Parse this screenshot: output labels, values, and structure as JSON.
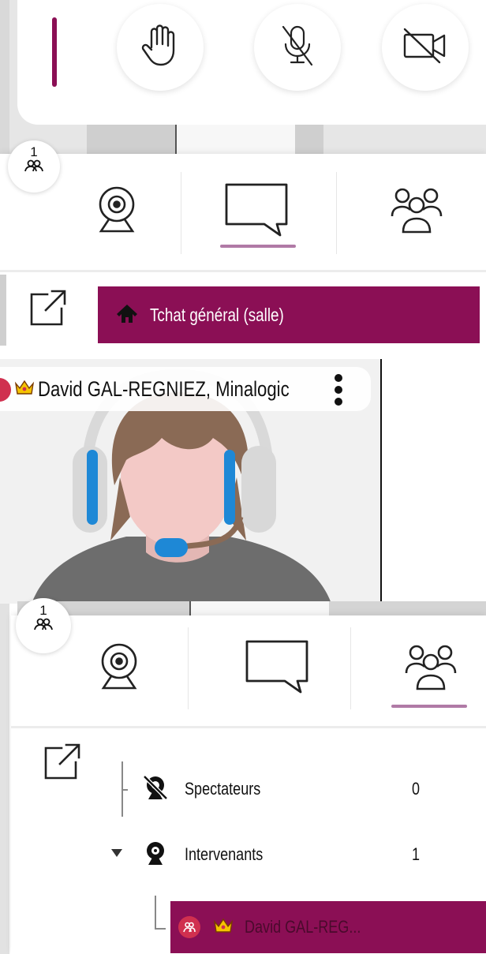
{
  "toolbar": {
    "raise_hand_icon": "hand-icon",
    "mic_icon": "mic-off-icon",
    "camera_icon": "camera-off-icon"
  },
  "panel1": {
    "badge_count": "1",
    "room_chat_label": "Tchat général (salle)"
  },
  "video": {
    "participant_name": "David GAL-REGNIEZ, Minalogic"
  },
  "panel2": {
    "badge_count": "1",
    "groups": [
      {
        "label": "Spectateurs",
        "count": "0"
      },
      {
        "label": "Intervenants",
        "count": "1"
      }
    ],
    "selected_user": "David GAL-REG..."
  },
  "colors": {
    "accent": "#8b0f55",
    "underline": "#b07aa6",
    "shadow_gray": "#c8c8c8"
  }
}
